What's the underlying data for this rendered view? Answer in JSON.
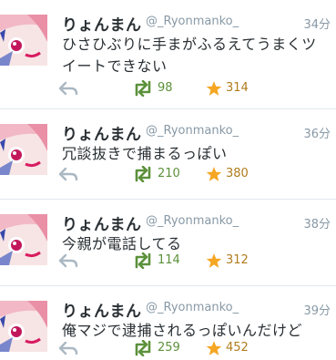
{
  "colors": {
    "retweet": "#5c913b",
    "favorite": "#f5a623",
    "meta": "#8899a6",
    "border": "#e1e8ed"
  },
  "tweets": [
    {
      "name": "りょんまん",
      "handle": "@_Ryonmanko_",
      "time": "34分",
      "text": "ひさひぶりに手まがふるえてうまくツ\nイートできない",
      "retweets": "98",
      "favorites": "314",
      "icons": [
        "reply-icon",
        "retweet-icon",
        "favorite-star-icon"
      ]
    },
    {
      "name": "りょんまん",
      "handle": "@_Ryonmanko_",
      "time": "36分",
      "text": "冗談抜きで捕まるっぽい",
      "retweets": "210",
      "favorites": "380",
      "icons": [
        "reply-icon",
        "retweet-icon",
        "favorite-star-icon"
      ]
    },
    {
      "name": "りょんまん",
      "handle": "@_Ryonmanko_",
      "time": "38分",
      "text": "今親が電話してる",
      "retweets": "114",
      "favorites": "312",
      "icons": [
        "reply-icon",
        "retweet-icon",
        "favorite-star-icon"
      ]
    },
    {
      "name": "りょんまん",
      "handle": "@_Ryonmanko_",
      "time": "39分",
      "text": "俺マジで逮捕されるっぽいんだけど",
      "retweets": "259",
      "favorites": "452",
      "icons": [
        "reply-icon",
        "retweet-icon",
        "favorite-star-icon"
      ]
    }
  ]
}
